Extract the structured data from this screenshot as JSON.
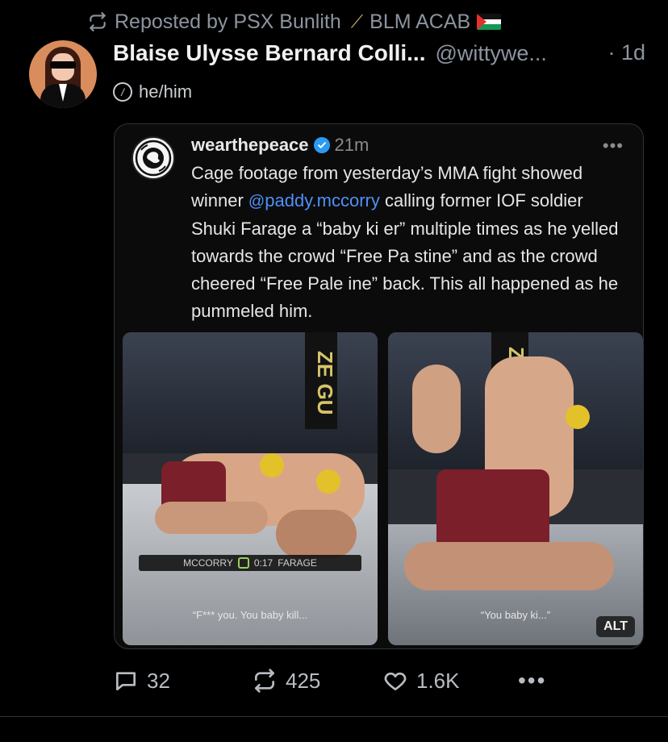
{
  "repost": {
    "label": "Reposted by PSX Bunlith",
    "suffix": "BLM ACAB",
    "icon": "repost-icon"
  },
  "post": {
    "display_name": "Blaise Ulysse Bernard Colli...",
    "handle": "@wittywe...",
    "time": "· 1d",
    "pronouns": "he/him",
    "pronoun_icon_glyph": "/"
  },
  "embed": {
    "username": "wearthepeace",
    "time": "21m",
    "more": "•••",
    "caption_pre": "Cage footage from yesterday’s MMA fight showed winner ",
    "mention": "paddy.mccorry",
    "caption_post": " calling former IOF soldier Shuki Farage a “baby ki  er” multiple times as he yelled towards the crowd “Free Pa  stine” and as the crowd cheered “Free Pale  ine” back. This all happened as he pummeled him.",
    "media": [
      {
        "cage_text": "ZE GU",
        "scoreboard_left": "MCCORRY",
        "clock": "0:17",
        "scoreboard_right": "FARAGE",
        "subtitle": "“F*** you. You baby kill..."
      },
      {
        "cage_text": "ZE C",
        "subtitle": "“You baby ki...”"
      }
    ],
    "alt_label": "ALT"
  },
  "actions": {
    "replies": "32",
    "reposts": "425",
    "likes": "1.6K",
    "more": "•••"
  },
  "colors": {
    "background": "#000000",
    "muted": "#8b949e",
    "mention": "#4f8ff7",
    "verified": "#2b9af3"
  }
}
